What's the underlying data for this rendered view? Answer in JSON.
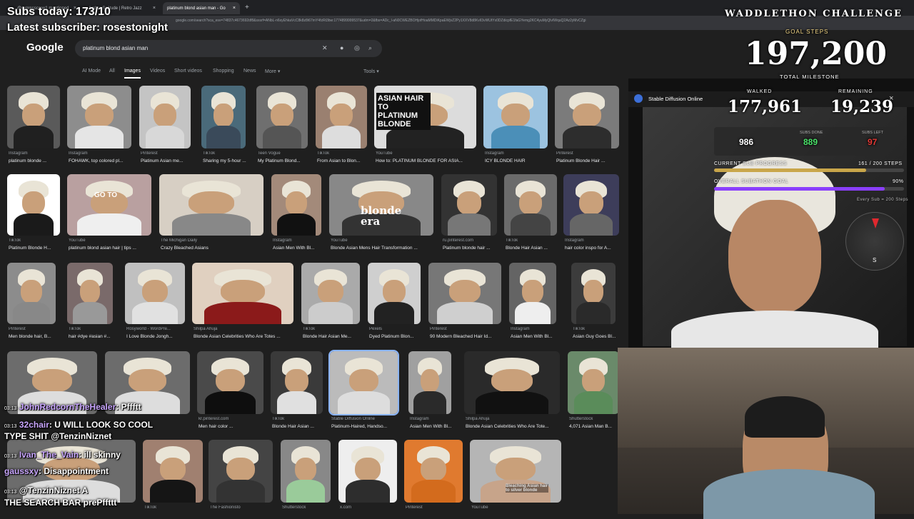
{
  "browser": {
    "tabs": [
      {
        "label": "@cypresscrew1 mentioned"
      },
      {
        "label": "Amber Solitude | Retro Jazz"
      },
      {
        "label": "platinum blond asian man - Go"
      }
    ],
    "url": "google.com/search?sca_esv=74837c4673692df8&sxsrf=ANbL-n6xyEhkaVcC8k8z8t67mY4fzRt3bw:1774899999537&udm=2&fbs=ADc_l-aN0CWEZBOHjofHoaMMDiKpaEWjvZ2Py1XXV8d8KvlI3vWUtYx0DZdicpfE1faGYemg2KC4yuMyQlvIWquQ2Az2yMvCZgi"
  },
  "google": {
    "logo": "Google",
    "query": "platinum blond asian man",
    "tabs": [
      "AI Mode",
      "All",
      "Images",
      "Videos",
      "Short videos",
      "Shopping",
      "News",
      "More"
    ],
    "tools": "Tools"
  },
  "results": [
    {
      "src": "Instagram",
      "title": "platinum blonde ..."
    },
    {
      "src": "Instagram",
      "title": "FOHAWK, top colored pl..."
    },
    {
      "src": "Pinterest",
      "title": "Platinum Asian me..."
    },
    {
      "src": "TikTok",
      "title": "Sharing my 5-hour ..."
    },
    {
      "src": "Teen Vogue",
      "title": "My Platinum Blond..."
    },
    {
      "src": "TikTok",
      "title": "From Asian to Blon..."
    },
    {
      "src": "YouTube",
      "title": "How to: PLATINUM BLONDE FOR ASIA..."
    },
    {
      "src": "Instagram",
      "title": "ICY BLONDE HAIR"
    },
    {
      "src": "Pinterest",
      "title": "Platinum Blonde Hair ..."
    },
    {
      "src": "TikTok",
      "title": "Platinum Blonde H..."
    },
    {
      "src": "YouTube",
      "title": "platinum blond asian hair | tips ..."
    },
    {
      "src": "The Michigan Daily",
      "title": "Crazy Bleached Asians"
    },
    {
      "src": "Instagram",
      "title": "Asian Men With Bl..."
    },
    {
      "src": "YouTube",
      "title": "Blonde Asian Mens Hair Transformation ..."
    },
    {
      "src": "ru.pinterest.com",
      "title": "Platinum blonde hair ..."
    },
    {
      "src": "TikTok",
      "title": "Blonde Hair Asian ..."
    },
    {
      "src": "Instagram",
      "title": "hair color inspo for A..."
    },
    {
      "src": "Pinterest",
      "title": "Men blonde hair, B..."
    },
    {
      "src": "TikTok",
      "title": "hair #dye #asian #..."
    },
    {
      "src": "Rosyworld - WordPre...",
      "title": "I Love Blonde Jongh..."
    },
    {
      "src": "Shilpa Ahuja",
      "title": "Blonde Asian Celebrities Who Are Totes ..."
    },
    {
      "src": "TikTok",
      "title": "Blonde Hair Asian Me..."
    },
    {
      "src": "Pexels",
      "title": "Dyed Platinum Blon..."
    },
    {
      "src": "Pinterest",
      "title": "90 Modern Bleached Hair Id..."
    },
    {
      "src": "Instagram",
      "title": "Asian Men With Bl..."
    },
    {
      "src": "TikTok",
      "title": "Asian Guy Goes Bl..."
    },
    {
      "src": "kr.pinterest.com",
      "title": "Men hair color ..."
    },
    {
      "src": "TikTok",
      "title": "Blonde Hair Asian ..."
    },
    {
      "src": "Stable Diffusion Online",
      "title": "Platinum-Haired, Handso..."
    },
    {
      "src": "Instagram",
      "title": "Asian Men With Bl..."
    },
    {
      "src": "Shilpa Ahuja",
      "title": "Blonde Asian Celebrities Who Are Tote..."
    },
    {
      "src": "Shutterstock",
      "title": "4,071 Asian Man B..."
    },
    {
      "src": "TikTok",
      "title": ""
    },
    {
      "src": "The Fashionisto",
      "title": ""
    },
    {
      "src": "Shutterstock",
      "title": ""
    },
    {
      "src": "x.com",
      "title": ""
    },
    {
      "src": "Pinterest",
      "title": ""
    },
    {
      "src": "YouTube",
      "title": ""
    }
  ],
  "thumb_texts": {
    "asian_hair": "ASIAN HAIR TO PLATINUM BLONDE",
    "go_to": "GO TO",
    "blonde_era": "blonde era",
    "bleaching": "Bleaching Asian hair to silver blonde"
  },
  "panel": {
    "title": "Stable Diffusion Online",
    "close": "×"
  },
  "stream": {
    "subs_today": "Subs today: 173/10",
    "latest_sub": "Latest subscriber: rosestonight",
    "challenge": "WADDLETHON CHALLENGE",
    "goal_label": "GOAL STEPS",
    "goal_value": "197,200",
    "total_milestone": "TOTAL MILESTONE",
    "walked_label": "WALKED",
    "walked_value": "177,961",
    "remaining_label": "REMAINING",
    "remaining_value": "19,239",
    "stats": [
      {
        "value": "986",
        "color": "#ffffff"
      },
      {
        "label": "SUBS DONE",
        "value": "889",
        "color": "#4be36a"
      },
      {
        "label": "SUBS LEFT",
        "value": "97",
        "color": "#e53935"
      }
    ],
    "current_sub_label": "CURRENT SUB PROGRESS",
    "current_sub_value": "161 / 200 STEPS",
    "current_sub_progress": 0.8,
    "overall_label": "OVERALL SUBATHON GOAL",
    "overall_value": "90%",
    "overall_progress": 0.9,
    "every_sub": "Every Sub = 200 Steps",
    "compass_s": "S"
  },
  "chat": [
    {
      "time": "03:13",
      "name": "JohnRedcornTheHealer",
      "msg": "Pffftt"
    },
    {
      "time": "03:13",
      "name": "32chair",
      "msg": "U WILL LOOK SO COOL"
    },
    {
      "time": "",
      "name": "",
      "msg": "TYPE SHIT @TenzinNiznet"
    },
    {
      "time": "03:13",
      "name": "Ivan_The_Vain",
      "msg": "ill skinny"
    },
    {
      "time": "",
      "name": "gaussxy",
      "msg": "Disappointment"
    },
    {
      "time": "03:13",
      "name": "",
      "msg": "@TenzinNiznet A"
    },
    {
      "time": "",
      "name": "",
      "msg": "THE SEARCH BAR prePffttt"
    }
  ],
  "colors": {
    "accent_purple": "#9c5cff",
    "bar_gold": "#c9a64a",
    "bar_purple": "#8a3ffc"
  }
}
